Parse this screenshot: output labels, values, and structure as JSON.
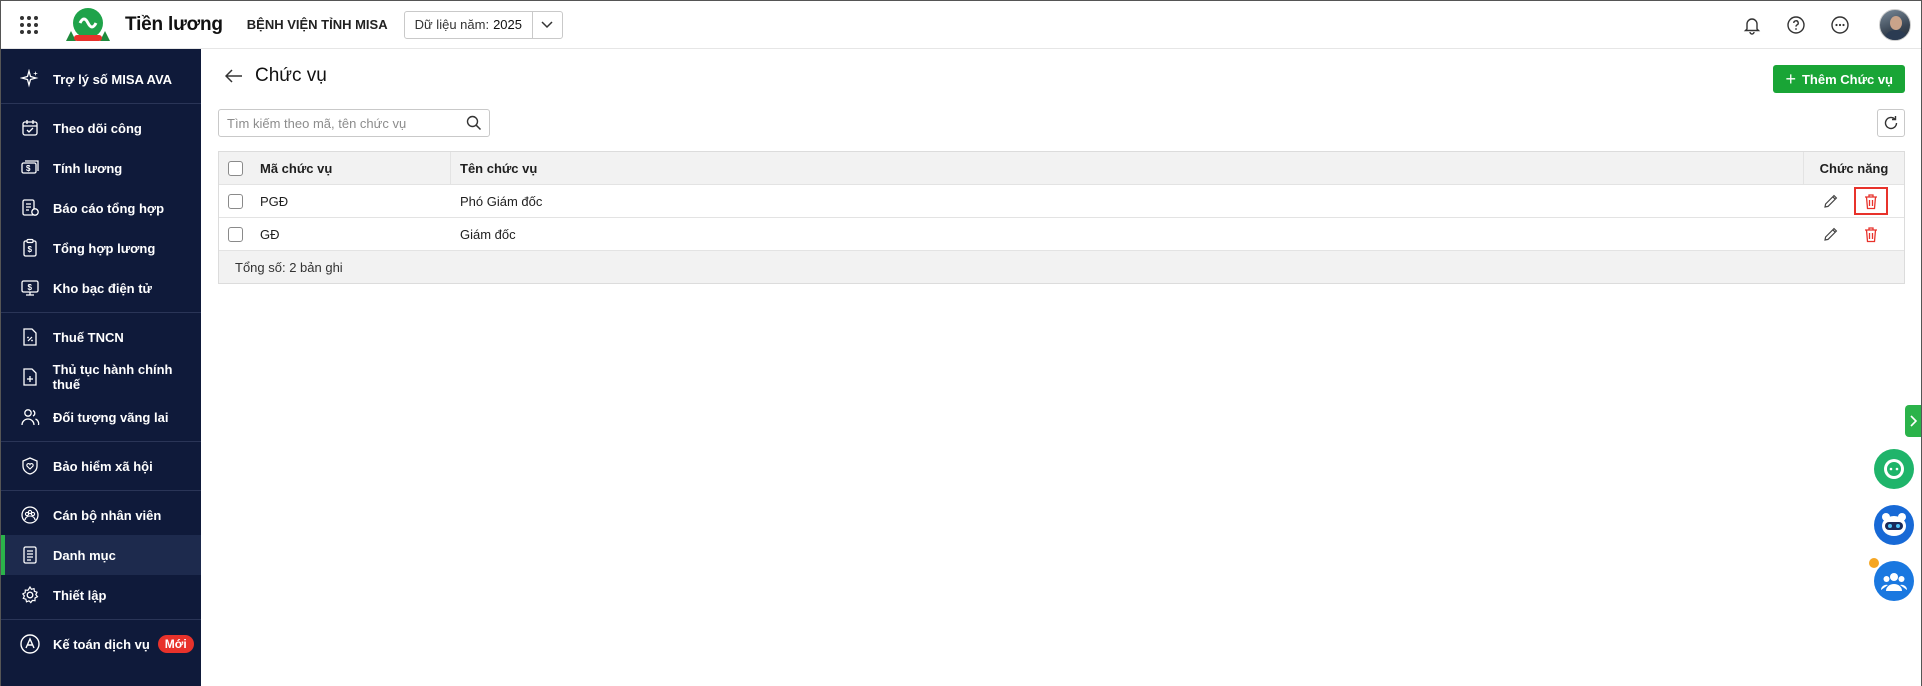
{
  "app": {
    "title": "Tiền lương",
    "org_name": "BỆNH VIỆN TỈNH MISA",
    "year_label": "Dữ liệu năm:",
    "year_value": "2025"
  },
  "sidebar": {
    "items": [
      {
        "label": "Trợ lý số MISA AVA",
        "icon": "sparkle-icon"
      },
      {
        "label": "Theo dõi công",
        "icon": "calendar-icon"
      },
      {
        "label": "Tính lương",
        "icon": "money-icon"
      },
      {
        "label": "Báo cáo tổng hợp",
        "icon": "report-icon"
      },
      {
        "label": "Tổng hợp lương",
        "icon": "clipboard-money-icon"
      },
      {
        "label": "Kho bạc điện tử",
        "icon": "monitor-money-icon"
      },
      {
        "label": "Thuế TNCN",
        "icon": "tax-document-icon"
      },
      {
        "label": "Thủ tục hành chính thuế",
        "icon": "document-plus-icon"
      },
      {
        "label": "Đối tượng vãng lai",
        "icon": "users-icon"
      },
      {
        "label": "Bảo hiểm xã hội",
        "icon": "shield-heart-icon"
      },
      {
        "label": "Cán bộ nhân viên",
        "icon": "team-icon"
      },
      {
        "label": "Danh mục",
        "icon": "list-document-icon"
      },
      {
        "label": "Thiết lập",
        "icon": "gear-icon"
      },
      {
        "label": "Kế toán dịch vụ",
        "icon": "accounting-icon",
        "badge": "Mới"
      }
    ],
    "active": "Danh mục"
  },
  "page": {
    "title": "Chức vụ",
    "add_button": "Thêm Chức vụ",
    "search_placeholder": "Tìm kiếm theo mã, tên chức vụ"
  },
  "table": {
    "columns": {
      "code": "Mã chức vụ",
      "name": "Tên chức vụ",
      "actions": "Chức năng"
    },
    "rows": [
      {
        "code": "PGĐ",
        "name": "Phó Giám đốc"
      },
      {
        "code": "GĐ",
        "name": "Giám đốc"
      }
    ],
    "footer": "Tổng số: 2 bản ghi"
  },
  "colors": {
    "primary_green": "#19a536",
    "sidebar_bg": "#0f1a3a",
    "delete_red": "#e8322b"
  }
}
